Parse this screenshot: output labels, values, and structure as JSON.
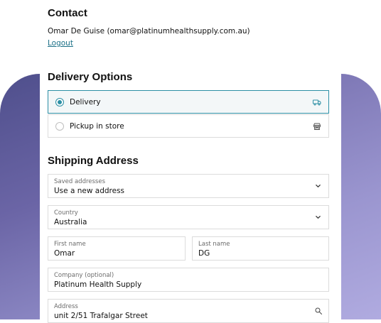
{
  "contact": {
    "title": "Contact",
    "user_line": "Omar De Guise (omar@platinumhealthsupply.com.au)",
    "logout": "Logout"
  },
  "delivery": {
    "title": "Delivery Options",
    "options": [
      {
        "label": "Delivery",
        "selected": true,
        "icon": "truck-icon"
      },
      {
        "label": "Pickup in store",
        "selected": false,
        "icon": "store-icon"
      }
    ]
  },
  "shipping": {
    "title": "Shipping Address",
    "saved": {
      "label": "Saved addresses",
      "value": "Use a new address"
    },
    "country": {
      "label": "Country",
      "value": "Australia"
    },
    "first_name": {
      "label": "First name",
      "value": "Omar"
    },
    "last_name": {
      "label": "Last name",
      "value": "DG"
    },
    "company": {
      "label": "Company (optional)",
      "value": "Platinum Health Supply"
    },
    "address": {
      "label": "Address",
      "value": "unit 2/51 Trafalgar Street"
    }
  },
  "colors": {
    "accent": "#2c8fa5",
    "link": "#1a6f86",
    "bg_gradient_left": "#4f4f8c",
    "bg_gradient_right": "#b0abe0"
  }
}
